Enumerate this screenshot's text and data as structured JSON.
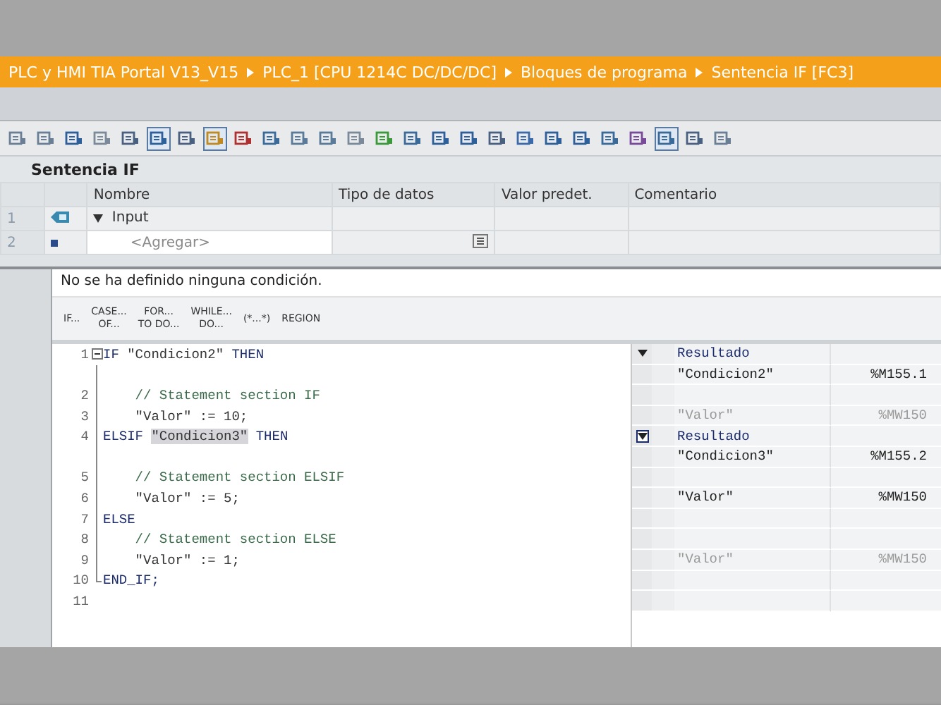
{
  "breadcrumb": [
    "PLC y HMI TIA Portal V13_V15",
    "PLC_1 [CPU 1214C DC/DC/DC]",
    "Bloques de programa",
    "Sentencia IF [FC3]"
  ],
  "toolbar": [
    {
      "selected": false
    },
    {
      "selected": false
    },
    {
      "selected": false
    },
    {
      "selected": false
    },
    {
      "selected": false
    },
    {
      "selected": true
    },
    {
      "selected": false
    },
    {
      "selected": true
    },
    {
      "selected": false
    },
    {
      "selected": false
    },
    {
      "selected": false
    },
    {
      "selected": false
    },
    {
      "selected": false
    },
    {
      "selected": false
    },
    {
      "selected": false
    },
    {
      "selected": false
    },
    {
      "selected": false
    },
    {
      "selected": false
    },
    {
      "selected": false
    },
    {
      "selected": false
    },
    {
      "selected": false
    },
    {
      "selected": false
    },
    {
      "selected": false
    },
    {
      "selected": true
    },
    {
      "selected": false
    },
    {
      "selected": false
    }
  ],
  "block_title": "Sentencia IF",
  "interface_table": {
    "columns": [
      "Nombre",
      "Tipo de datos",
      "Valor predet.",
      "Comentario"
    ],
    "rows": [
      {
        "number": "1",
        "kind": "section",
        "name": "Input",
        "expanded": true
      },
      {
        "number": "2",
        "kind": "add",
        "name": "<Agregar>"
      }
    ]
  },
  "message": "No se ha definido ninguna condición.",
  "palette": [
    "IF...",
    "CASE...\nOF...",
    "FOR...\nTO DO...",
    "WHILE...\nDO...",
    "(*...*)",
    "REGION"
  ],
  "code_lines": [
    {
      "number": "1",
      "in_block": false,
      "expanded": true,
      "segments": [
        {
          "kind": "keyword",
          "text": "IF "
        },
        {
          "kind": "operand",
          "text": "\"Condicion2\""
        },
        {
          "kind": "keyword",
          "text": " THEN"
        }
      ]
    },
    {
      "in_block": true
    },
    {
      "number": "2",
      "in_block": true,
      "segments": [
        {
          "kind": "comment",
          "text": "    // Statement section IF"
        }
      ]
    },
    {
      "number": "3",
      "in_block": true,
      "segments": [
        {
          "kind": "operand",
          "text": "    \"Valor\" := 10;"
        }
      ]
    },
    {
      "number": "4",
      "in_block": true,
      "segments": [
        {
          "kind": "keyword",
          "text": "ELSIF "
        },
        {
          "kind": "highlight",
          "text": "\"Condicion3\""
        },
        {
          "kind": "keyword",
          "text": " THEN"
        }
      ]
    },
    {
      "in_block": true
    },
    {
      "number": "5",
      "in_block": true,
      "segments": [
        {
          "kind": "comment",
          "text": "    // Statement section ELSIF"
        }
      ]
    },
    {
      "number": "6",
      "in_block": true,
      "segments": [
        {
          "kind": "operand",
          "text": "    \"Valor\" := 5;"
        }
      ]
    },
    {
      "number": "7",
      "in_block": true,
      "segments": [
        {
          "kind": "keyword",
          "text": "ELSE"
        }
      ]
    },
    {
      "number": "8",
      "in_block": true,
      "segments": [
        {
          "kind": "comment",
          "text": "    // Statement section ELSE"
        }
      ]
    },
    {
      "number": "9",
      "in_block": true,
      "segments": [
        {
          "kind": "operand",
          "text": "    \"Valor\" := 1;"
        }
      ]
    },
    {
      "number": "10",
      "in_block": true,
      "block_end": true,
      "segments": [
        {
          "kind": "keyword",
          "text": "END_IF;"
        }
      ]
    },
    {
      "number": "11",
      "in_block": false
    }
  ],
  "monitor_rows": [
    {
      "kind": "header",
      "label": "Resultado",
      "focused": false
    },
    {
      "kind": "value",
      "name": "\"Condicion2\"",
      "address": "%M155.1",
      "dimmed": false
    },
    {
      "kind": "empty"
    },
    {
      "kind": "value",
      "name": "\"Valor\"",
      "address": "%MW150",
      "dimmed": true
    },
    {
      "kind": "header",
      "label": "Resultado",
      "focused": true
    },
    {
      "kind": "value",
      "name": "\"Condicion3\"",
      "address": "%M155.2",
      "dimmed": false
    },
    {
      "kind": "empty"
    },
    {
      "kind": "value",
      "name": "\"Valor\"",
      "address": "%MW150",
      "dimmed": false
    },
    {
      "kind": "empty"
    },
    {
      "kind": "empty"
    },
    {
      "kind": "value",
      "name": "\"Valor\"",
      "address": "%MW150",
      "dimmed": true
    },
    {
      "kind": "empty"
    },
    {
      "kind": "empty"
    }
  ]
}
